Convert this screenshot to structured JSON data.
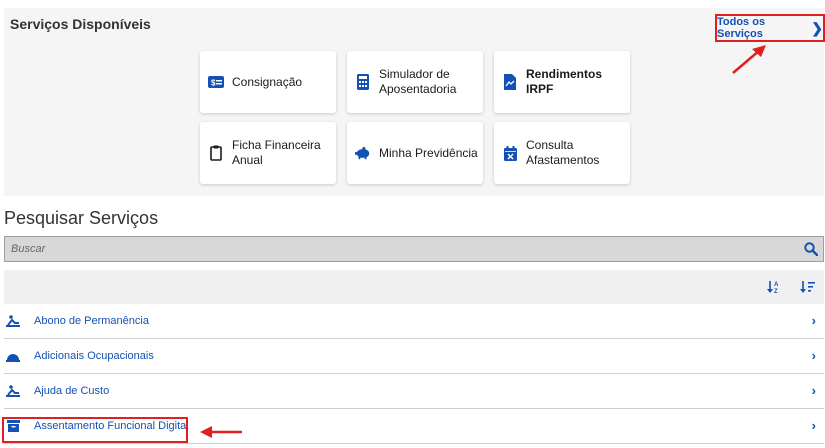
{
  "panel": {
    "title": "Serviços Disponíveis",
    "all_services_label": "Todos os Serviços",
    "cards": [
      {
        "label": "Consignação",
        "icon": "money-card-icon"
      },
      {
        "label": "Simulador de Aposentadoria",
        "icon": "calculator-icon"
      },
      {
        "label": "Rendimentos IRPF",
        "icon": "document-icon"
      },
      {
        "label": "Ficha Financeira Anual",
        "icon": "clipboard-icon"
      },
      {
        "label": "Minha Previdência",
        "icon": "piggy-bank-icon"
      },
      {
        "label": "Consulta Afastamentos",
        "icon": "calendar-x-icon"
      }
    ]
  },
  "search": {
    "title": "Pesquisar Serviços",
    "placeholder": "Buscar"
  },
  "list": {
    "items": [
      {
        "label": "Abono de Permanência",
        "icon": "person-relax-icon"
      },
      {
        "label": "Adicionais Ocupacionais",
        "icon": "helmet-icon"
      },
      {
        "label": "Ajuda de Custo",
        "icon": "person-relax-icon"
      },
      {
        "label": "Assentamento Funcional Digital",
        "icon": "archive-box-icon"
      }
    ]
  },
  "colors": {
    "primary": "#1351b4",
    "highlight": "#e02020",
    "panel_bg": "#f5f5f5"
  }
}
